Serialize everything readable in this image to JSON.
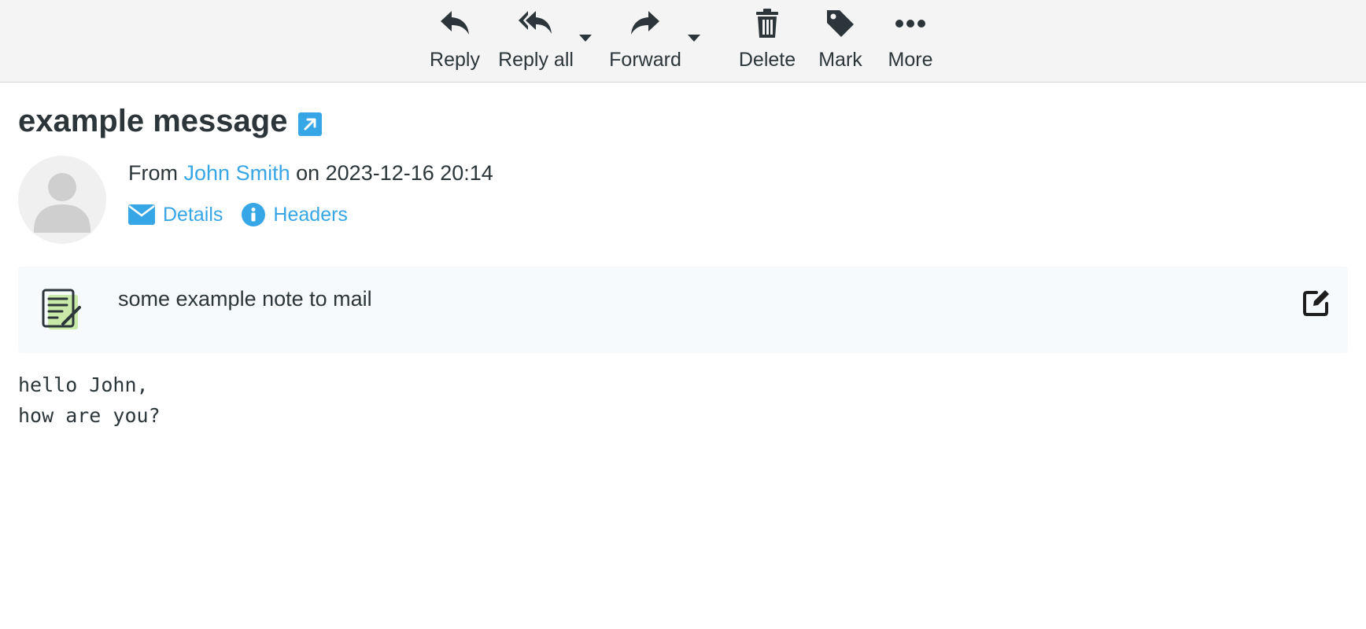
{
  "toolbar": {
    "reply": {
      "label": "Reply",
      "icon": "reply-icon"
    },
    "reply_all": {
      "label": "Reply all",
      "icon": "reply-all-icon"
    },
    "forward": {
      "label": "Forward",
      "icon": "forward-icon"
    },
    "delete": {
      "label": "Delete",
      "icon": "trash-icon"
    },
    "mark": {
      "label": "Mark",
      "icon": "tag-icon"
    },
    "more": {
      "label": "More",
      "icon": "ellipsis-icon"
    }
  },
  "message": {
    "subject": "example message",
    "from_prefix": "From",
    "sender": "John Smith",
    "date_text": "on 2023-12-16 20:14",
    "links": {
      "details": "Details",
      "headers": "Headers"
    },
    "note": "some example note to mail",
    "body_lines": [
      "hello John,",
      "",
      "how are you?"
    ]
  },
  "colors": {
    "accent": "#37a6e6",
    "text": "#2c363a",
    "toolbar_bg": "#f4f4f4",
    "note_bg": "#f6fafd"
  }
}
